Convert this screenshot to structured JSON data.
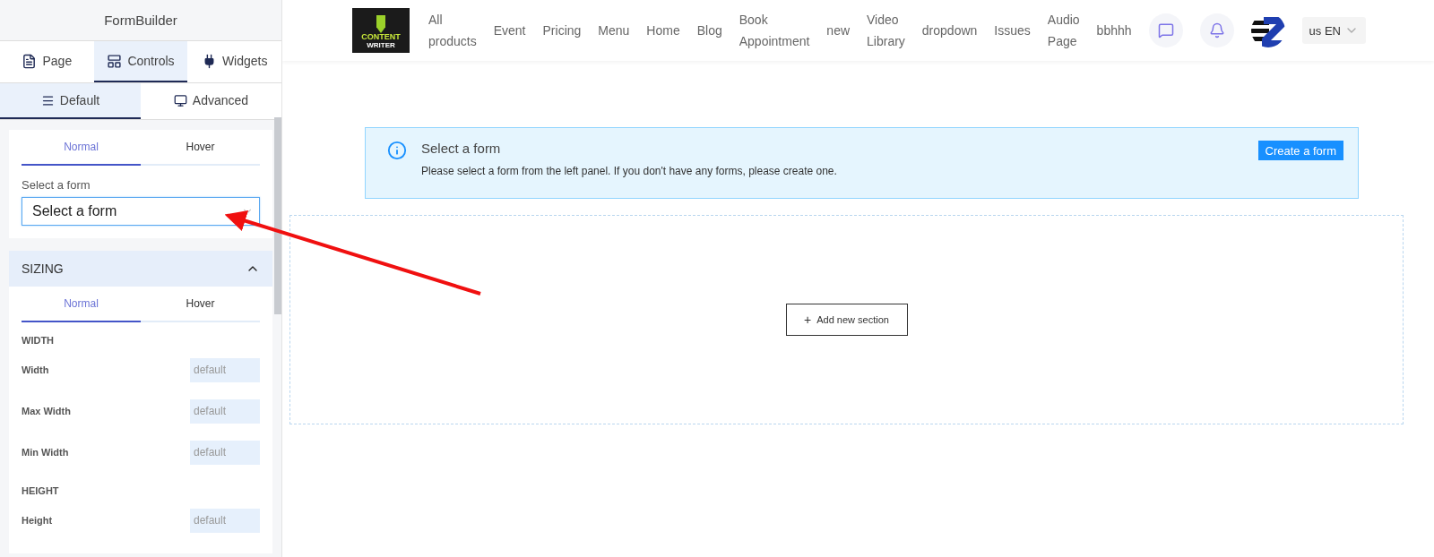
{
  "sidebar": {
    "title": "FormBuilder",
    "tabs": [
      {
        "label": "Page",
        "selected": false
      },
      {
        "label": "Controls",
        "selected": true
      },
      {
        "label": "Widgets",
        "selected": false
      }
    ],
    "subtabs": [
      {
        "label": "Default",
        "selected": true
      },
      {
        "label": "Advanced",
        "selected": false
      }
    ],
    "form_card": {
      "state_tabs": [
        {
          "label": "Normal",
          "selected": true
        },
        {
          "label": "Hover",
          "selected": false
        }
      ],
      "label": "Select a form",
      "select": {
        "value": "Select a form"
      }
    },
    "sizing": {
      "title": "SIZING",
      "expanded": true,
      "state_tabs": [
        {
          "label": "Normal",
          "selected": true
        },
        {
          "label": "Hover",
          "selected": false
        }
      ],
      "rows": [
        {
          "kind": "heading",
          "label": "WIDTH"
        },
        {
          "kind": "field",
          "label": "Width",
          "placeholder": "default"
        },
        {
          "kind": "field",
          "label": "Max Width",
          "placeholder": "default"
        },
        {
          "kind": "field",
          "label": "Min Width",
          "placeholder": "default"
        },
        {
          "kind": "heading",
          "label": "HEIGHT"
        },
        {
          "kind": "field",
          "label": "Height",
          "placeholder": "default"
        }
      ]
    }
  },
  "navbar": {
    "logo": {
      "line1": "CONTENT",
      "line2": "WRITER"
    },
    "links": [
      "All products",
      "Event",
      "Pricing",
      "Menu",
      "Home",
      "Blog",
      "Book Appointment",
      "new",
      "Video Library",
      "dropdown",
      "Issues",
      "Audio Page",
      "bbhhh"
    ],
    "language": "us EN"
  },
  "alert": {
    "title": "Select a form",
    "message": "Please select a form from the left panel. If you don't have any forms, please create one.",
    "button": "Create a form"
  },
  "section": {
    "button_icon": "+",
    "button": "Add new section"
  }
}
